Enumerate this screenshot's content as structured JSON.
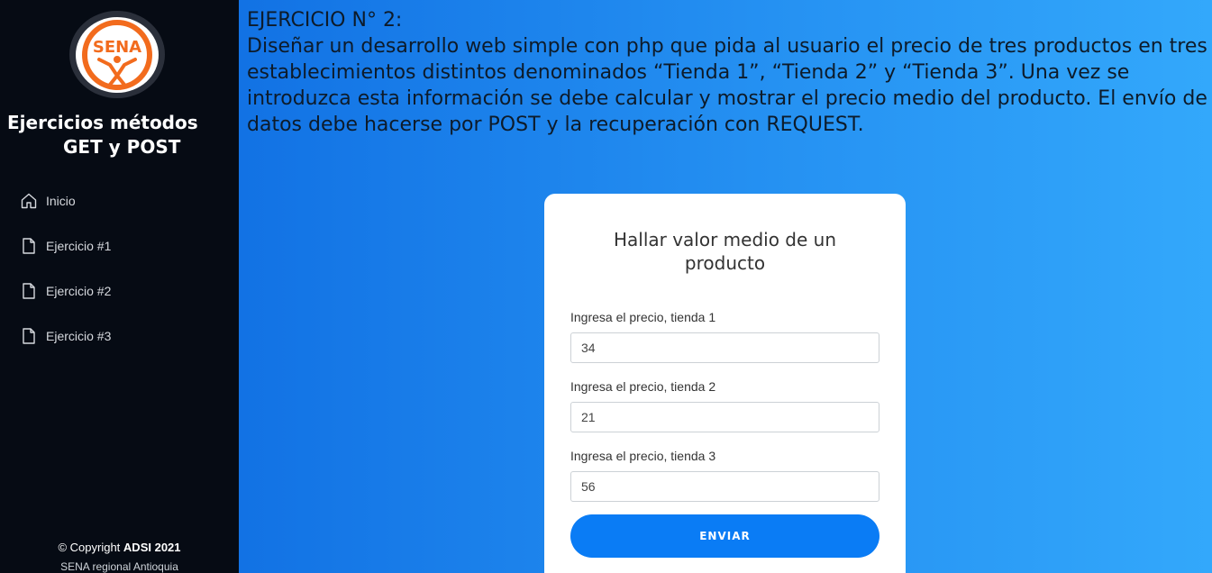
{
  "sidebar": {
    "logo_text": "SENA",
    "brand_line1": "Ejercicios métodos",
    "brand_line2": "GET y POST",
    "items": [
      {
        "label": "Inicio",
        "icon": "home-icon"
      },
      {
        "label": "Ejercicio #1",
        "icon": "file-icon"
      },
      {
        "label": "Ejercicio #2",
        "icon": "file-icon"
      },
      {
        "label": "Ejercicio #3",
        "icon": "file-icon"
      }
    ],
    "footer_prefix": "© Copyright ",
    "footer_brand": "ADSI 2021",
    "footer_sub": "SENA regional Antioquia"
  },
  "main": {
    "exercise_title": "EJERCICIO N° 2:",
    "exercise_body": "Diseñar un desarrollo web simple con php que pida al usuario el precio de tres productos en tres establecimientos distintos denominados “Tienda 1”, “Tienda 2” y “Tienda 3”. Una vez se introduzca esta información se debe calcular y mostrar el precio medio del producto. El envío de datos debe hacerse por POST y la recuperación con REQUEST."
  },
  "form": {
    "title": "Hallar valor medio de un producto",
    "fields": [
      {
        "label": "Ingresa el precio, tienda 1",
        "value": "34"
      },
      {
        "label": "Ingresa el precio, tienda 2",
        "value": "21"
      },
      {
        "label": "Ingresa el precio, tienda 3",
        "value": "56"
      }
    ],
    "submit_label": "ENVIAR"
  },
  "colors": {
    "sidebar_bg": "#060b14",
    "accent": "#0a7cf5",
    "sena_orange": "#f26b1d"
  }
}
